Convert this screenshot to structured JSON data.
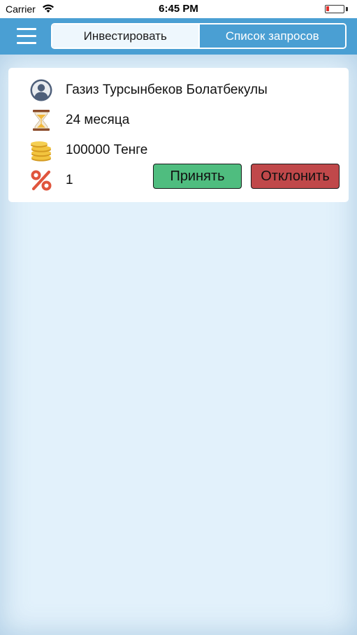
{
  "status_bar": {
    "carrier": "Carrier",
    "time": "6:45 PM",
    "battery_color": "#e0302a"
  },
  "nav": {
    "menu_icon": "hamburger-menu-icon",
    "tabs": [
      {
        "label": "Инвестировать",
        "selected": false
      },
      {
        "label": "Список запросов",
        "selected": true
      }
    ],
    "accent_color": "#4a9fd3"
  },
  "requests": [
    {
      "name": "Газиз Турсынбеков Болатбекулы",
      "term": "24 месяца",
      "amount": "100000 Тенге",
      "percent": "1",
      "accept_label": "Принять",
      "decline_label": "Отклонить",
      "icons": [
        "user-avatar-icon",
        "hourglass-icon",
        "coins-icon",
        "percent-icon"
      ]
    }
  ],
  "colors": {
    "accept": "#4fbd7f",
    "decline": "#c0484a",
    "background": "#e2f1fb"
  }
}
